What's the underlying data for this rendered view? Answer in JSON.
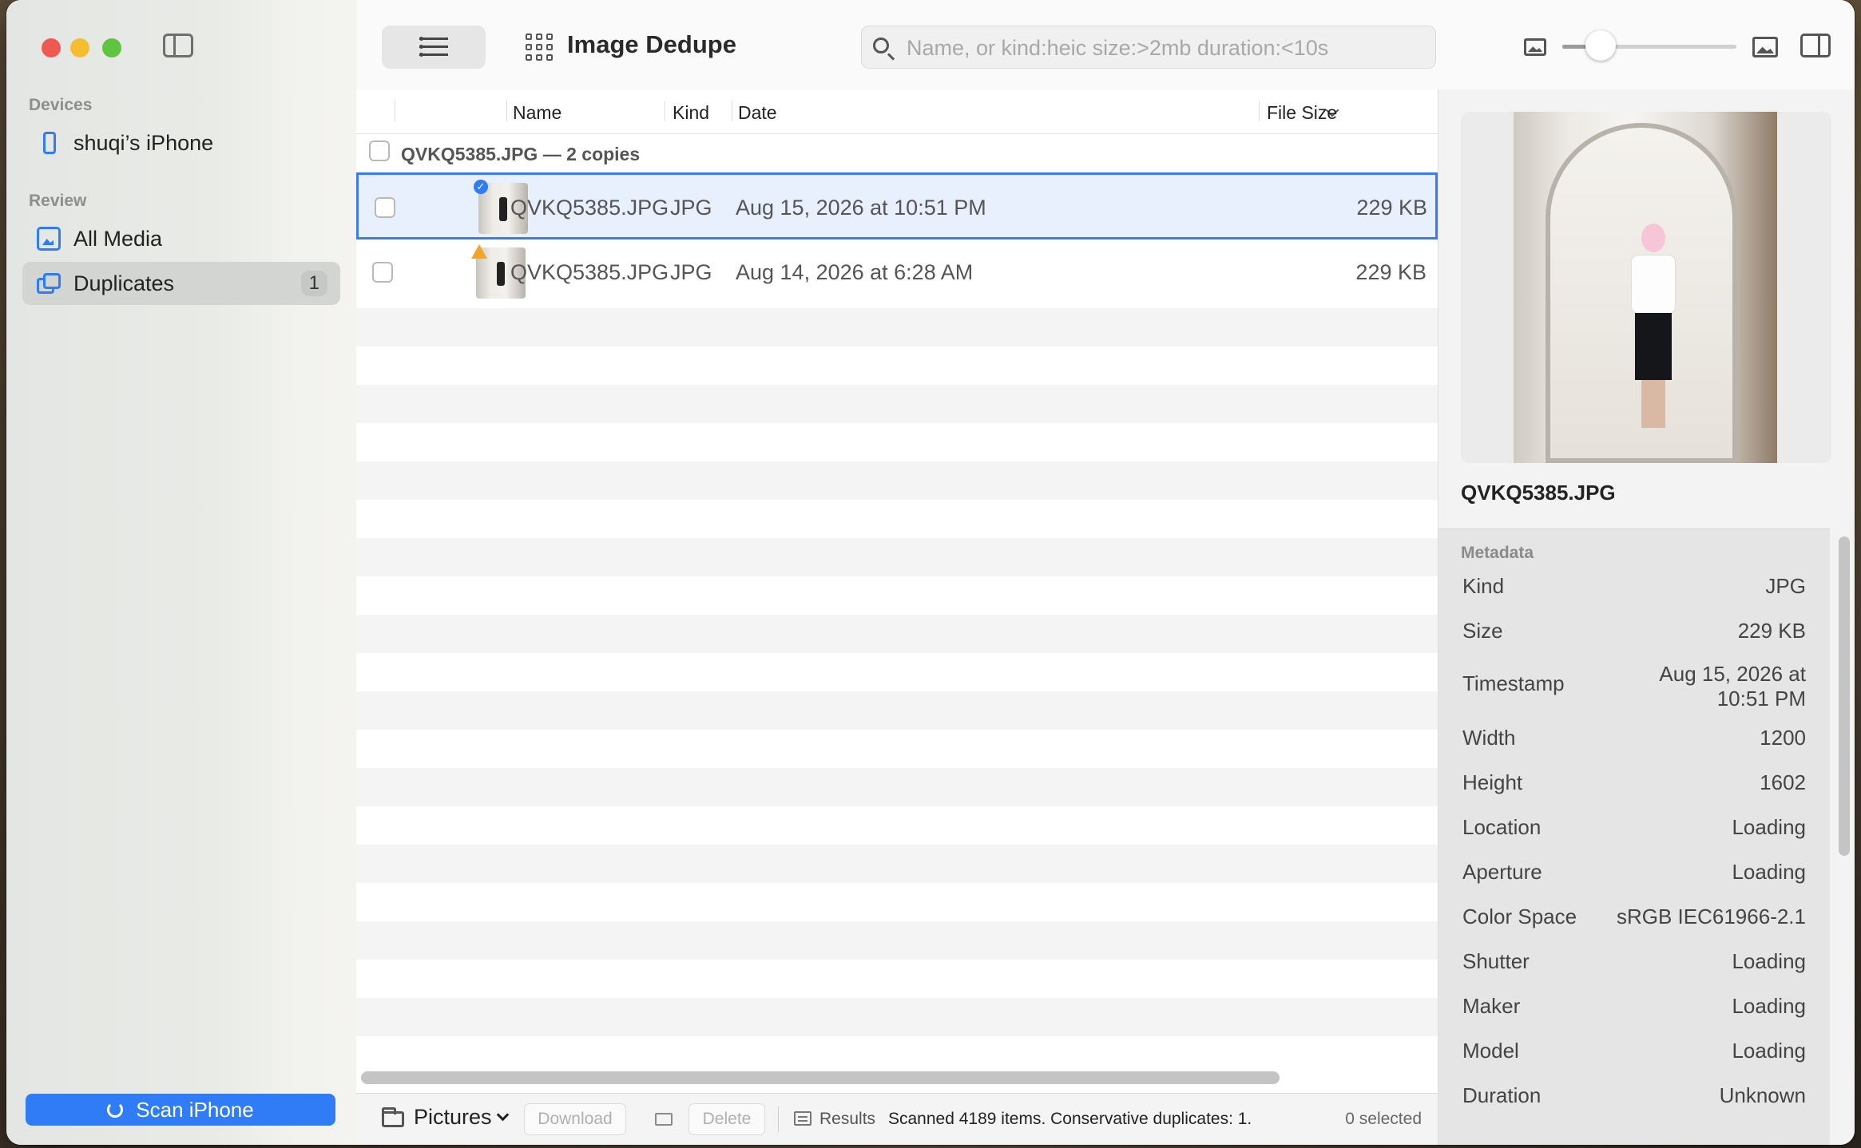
{
  "window": {
    "title": "Image Dedupe"
  },
  "sidebar": {
    "devices_label": "Devices",
    "device_name": "shuqi’s iPhone",
    "review_label": "Review",
    "items": [
      {
        "label": "All Media",
        "icon": "media-icon"
      },
      {
        "label": "Duplicates",
        "icon": "duplicates-icon",
        "badge": "1",
        "active": true
      }
    ],
    "scan_button": "Scan iPhone"
  },
  "toolbar": {
    "search_placeholder": "Name, or kind:heic size:>2mb duration:<10s",
    "thumbnail_size_fraction": 0.22
  },
  "table": {
    "headers": {
      "name": "Name",
      "kind": "Kind",
      "date": "Date",
      "size": "File Size"
    },
    "group_label": "QVKQ5385.JPG — 2 copies",
    "rows": [
      {
        "name": "QVKQ5385.JPG",
        "kind": "JPG",
        "date": "Aug 15, 2026 at 10:51 PM",
        "size": "229 KB",
        "selected": true,
        "badge": "check"
      },
      {
        "name": "QVKQ5385.JPG",
        "kind": "JPG",
        "date": "Aug 14, 2026 at 6:28 AM",
        "size": "229 KB",
        "selected": false,
        "badge": "warning"
      }
    ]
  },
  "bottombar": {
    "folder": "Pictures",
    "download": "Download",
    "delete": "Delete",
    "results": "Results",
    "status": "Scanned 4189 items. Conservative duplicates: 1.",
    "selected": "0 selected"
  },
  "inspector": {
    "file_name": "QVKQ5385.JPG",
    "metadata_label": "Metadata",
    "metadata": [
      {
        "key": "Kind",
        "value": "JPG"
      },
      {
        "key": "Size",
        "value": "229 KB"
      },
      {
        "key": "Timestamp",
        "value": "Aug 15, 2026 at 10:51 PM"
      },
      {
        "key": "Width",
        "value": "1200"
      },
      {
        "key": "Height",
        "value": "1602"
      },
      {
        "key": "Location",
        "value": "Loading"
      },
      {
        "key": "Aperture",
        "value": "Loading"
      },
      {
        "key": "Color Space",
        "value": "sRGB IEC61966-2.1"
      },
      {
        "key": "Shutter",
        "value": "Loading"
      },
      {
        "key": "Maker",
        "value": "Loading"
      },
      {
        "key": "Model",
        "value": "Loading"
      },
      {
        "key": "Duration",
        "value": "Unknown"
      }
    ]
  },
  "colors": {
    "accent": "#2f7cf6",
    "warning": "#f3a626",
    "selection": "#e8effd"
  }
}
